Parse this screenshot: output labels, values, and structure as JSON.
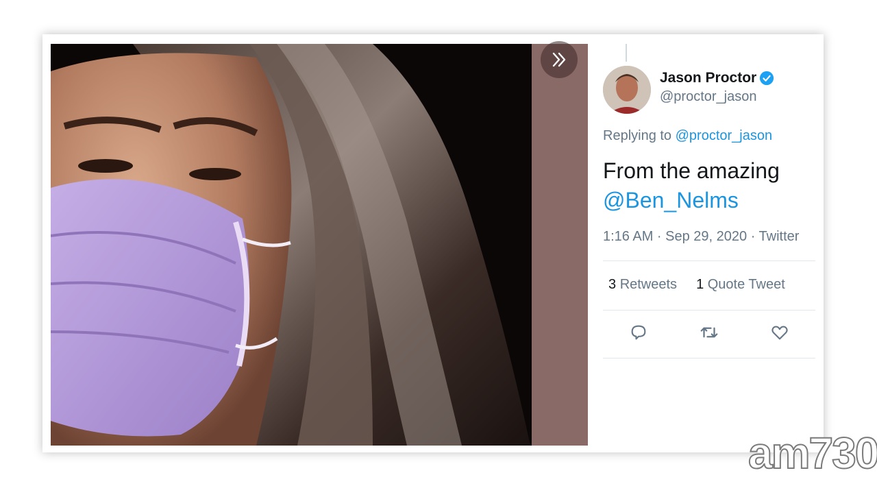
{
  "tweet": {
    "display_name": "Jason Proctor",
    "handle": "@proctor_jason",
    "verified": true,
    "replying_prefix": "Replying to",
    "replying_handle": "@proctor_jason",
    "text_plain": "From the amazing",
    "text_mention": "@Ben_Nelms",
    "timestamp": "1:16 AM · Sep 29, 2020 · Twitter",
    "retweets_count": "3",
    "retweets_label": "Retweets",
    "quotes_count": "1",
    "quotes_label": "Quote Tweet",
    "actions": [
      "reply-icon",
      "retweet-icon",
      "like-icon"
    ]
  },
  "colors": {
    "link": "#1b95e0",
    "text_primary": "#14171a",
    "text_secondary": "#657786",
    "mask": "#b39ad8",
    "verified": "#1da1f2"
  },
  "watermark": "am730"
}
